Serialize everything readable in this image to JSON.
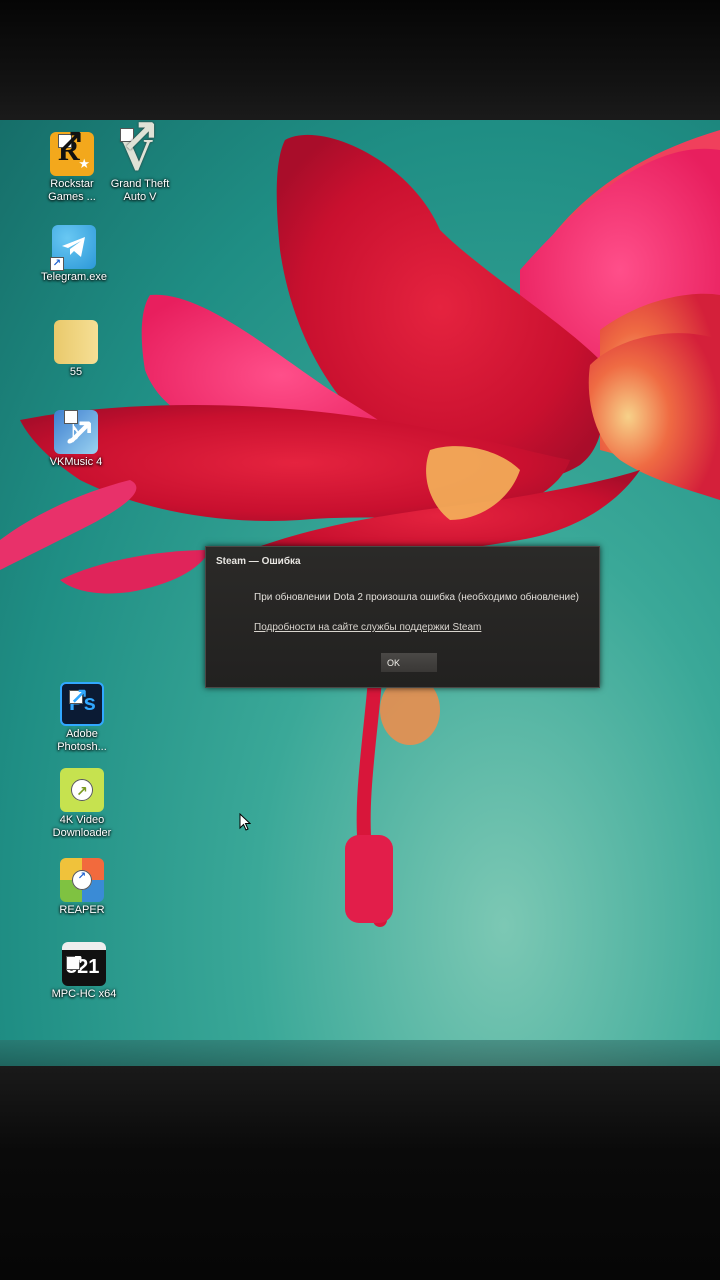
{
  "desktop": {
    "icons": [
      {
        "name": "rockstar-games-launcher",
        "label": "Rockstar Games ..."
      },
      {
        "name": "gta-v",
        "label": "Grand Theft Auto V"
      },
      {
        "name": "telegram",
        "label": "Telegram.exe"
      },
      {
        "name": "folder-55",
        "label": "55"
      },
      {
        "name": "vkmusic",
        "label": "VKMusic 4"
      },
      {
        "name": "photoshop",
        "label": "Adobe Photosh..."
      },
      {
        "name": "4k-video-downloader",
        "label": "4K Video Downloader"
      },
      {
        "name": "reaper",
        "label": "REAPER"
      },
      {
        "name": "mpc-hc",
        "label": "MPC-HC x64"
      }
    ]
  },
  "dialog": {
    "title": "Steam — Ошибка",
    "message": "При обновлении Dota 2 произошла ошибка (необходимо обновление)",
    "link": "Подробности на сайте службы поддержки Steam",
    "ok_label": "OK"
  },
  "colors": {
    "wallpaper_teal": "#2a9d90",
    "flower_red": "#d8163a",
    "dialog_bg": "#262523"
  }
}
